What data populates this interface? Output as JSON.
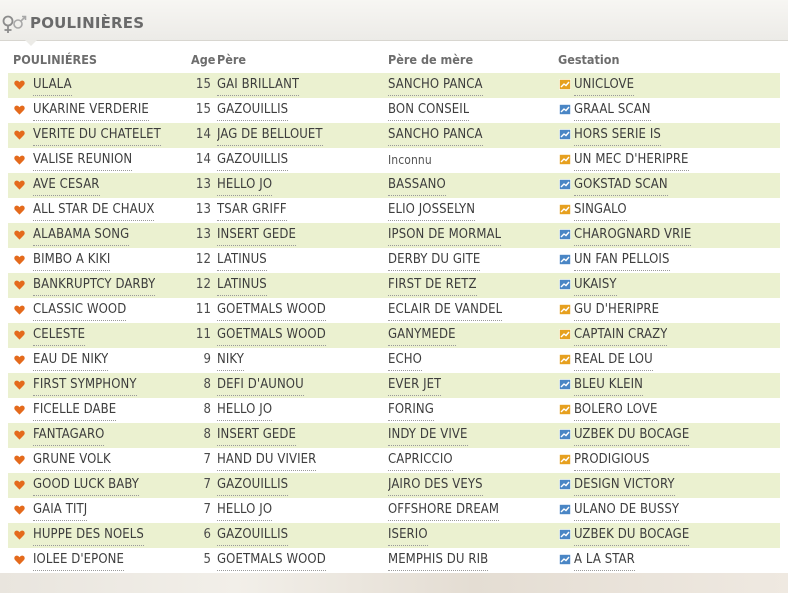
{
  "section": {
    "title": "POULINIÈRES",
    "icon": "male-female-icon"
  },
  "columns": {
    "mare": "POULINIÉRES",
    "age": "Age",
    "sire": "Père",
    "dam_sire": "Père de mère",
    "gestation": "Gestation"
  },
  "colors": {
    "heart": "#e46a1c",
    "gestation_orange": "#e6a01f",
    "gestation_blue": "#4a86c5",
    "row_highlight": "#ebf1d0"
  },
  "rows": [
    {
      "mare": "ULALA",
      "age": "15",
      "sire": "GAI BRILLANT",
      "dam_sire": "SANCHO PANCA",
      "gestation": "UNICLOVE",
      "gestation_icon": "orange"
    },
    {
      "mare": "UKARINE VERDERIE",
      "age": "15",
      "sire": "GAZOUILLIS",
      "dam_sire": "BON CONSEIL",
      "gestation": "GRAAL SCAN",
      "gestation_icon": "blue"
    },
    {
      "mare": "VERITE DU CHATELET",
      "age": "14",
      "sire": "JAG DE BELLOUET",
      "dam_sire": "SANCHO PANCA",
      "gestation": "HORS SERIE IS",
      "gestation_icon": "blue"
    },
    {
      "mare": "VALISE REUNION",
      "age": "14",
      "sire": "GAZOUILLIS",
      "dam_sire": "Inconnu",
      "gestation": "UN MEC D'HERIPRE",
      "gestation_icon": "orange"
    },
    {
      "mare": "AVE CESAR",
      "age": "13",
      "sire": "HELLO JO",
      "dam_sire": "BASSANO",
      "gestation": "GOKSTAD SCAN",
      "gestation_icon": "blue"
    },
    {
      "mare": "ALL STAR DE CHAUX",
      "age": "13",
      "sire": "TSAR GRIFF",
      "dam_sire": "ELIO JOSSELYN",
      "gestation": "SINGALO",
      "gestation_icon": "orange"
    },
    {
      "mare": "ALABAMA SONG",
      "age": "13",
      "sire": "INSERT GEDE",
      "dam_sire": "IPSON DE MORMAL",
      "gestation": "CHAROGNARD VRIE",
      "gestation_icon": "blue"
    },
    {
      "mare": "BIMBO A KIKI",
      "age": "12",
      "sire": "LATINUS",
      "dam_sire": "DERBY DU GITE",
      "gestation": "UN FAN PELLOIS",
      "gestation_icon": "blue"
    },
    {
      "mare": "BANKRUPTCY DARBY",
      "age": "12",
      "sire": "LATINUS",
      "dam_sire": "FIRST DE RETZ",
      "gestation": "UKAISY",
      "gestation_icon": "blue"
    },
    {
      "mare": "CLASSIC WOOD",
      "age": "11",
      "sire": "GOETMALS WOOD",
      "dam_sire": "ECLAIR DE VANDEL",
      "gestation": "GU D'HERIPRE",
      "gestation_icon": "orange"
    },
    {
      "mare": "CELESTE",
      "age": "11",
      "sire": "GOETMALS WOOD",
      "dam_sire": "GANYMEDE",
      "gestation": "CAPTAIN CRAZY",
      "gestation_icon": "orange"
    },
    {
      "mare": "EAU DE NIKY",
      "age": "9",
      "sire": "NIKY",
      "dam_sire": "ECHO",
      "gestation": "REAL DE LOU",
      "gestation_icon": "orange"
    },
    {
      "mare": "FIRST SYMPHONY",
      "age": "8",
      "sire": "DEFI D'AUNOU",
      "dam_sire": "EVER JET",
      "gestation": "BLEU KLEIN",
      "gestation_icon": "blue"
    },
    {
      "mare": "FICELLE DABE",
      "age": "8",
      "sire": "HELLO JO",
      "dam_sire": "FORING",
      "gestation": "BOLERO LOVE",
      "gestation_icon": "orange"
    },
    {
      "mare": "FANTAGARO",
      "age": "8",
      "sire": "INSERT GEDE",
      "dam_sire": "INDY DE VIVE",
      "gestation": "UZBEK DU BOCAGE",
      "gestation_icon": "blue"
    },
    {
      "mare": "GRUNE VOLK",
      "age": "7",
      "sire": "HAND DU VIVIER",
      "dam_sire": "CAPRICCIO",
      "gestation": "PRODIGIOUS",
      "gestation_icon": "orange"
    },
    {
      "mare": "GOOD LUCK BABY",
      "age": "7",
      "sire": "GAZOUILLIS",
      "dam_sire": "JAIRO DES VEYS",
      "gestation": "DESIGN VICTORY",
      "gestation_icon": "blue"
    },
    {
      "mare": "GAIA TITJ",
      "age": "7",
      "sire": "HELLO JO",
      "dam_sire": "OFFSHORE DREAM",
      "gestation": "ULANO DE BUSSY",
      "gestation_icon": "blue"
    },
    {
      "mare": "HUPPE DES NOELS",
      "age": "6",
      "sire": "GAZOUILLIS",
      "dam_sire": "ISERIO",
      "gestation": "UZBEK DU BOCAGE",
      "gestation_icon": "blue"
    },
    {
      "mare": "IOLEE D'EPONE",
      "age": "5",
      "sire": "GOETMALS WOOD",
      "dam_sire": "MEMPHIS DU RIB",
      "gestation": "A LA STAR",
      "gestation_icon": "blue"
    }
  ]
}
